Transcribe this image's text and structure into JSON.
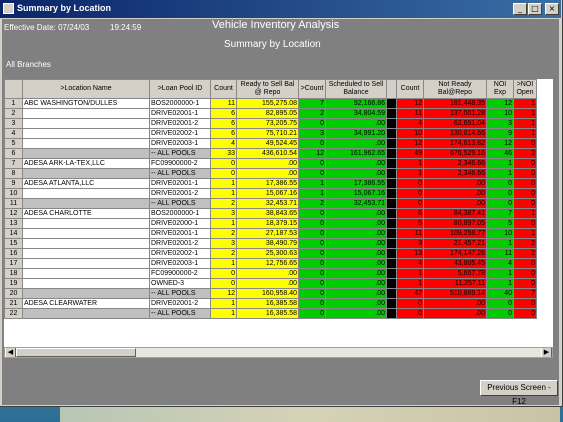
{
  "window": {
    "title": "Summary by Location"
  },
  "header": {
    "effective_date_label": "Effective Date: 07/24/03",
    "time": "19:24:59",
    "title": "Vehicle Inventory Analysis",
    "subtitle": "Summary by Location",
    "branch": "All Branches"
  },
  "colors": {
    "yellow": "#ffff00",
    "green": "#00cc00",
    "red": "#ff0000",
    "titlebar": "#0a246a"
  },
  "columns": [
    ">Location Name",
    ">Loan Pool ID",
    "Count",
    "Ready to Sell Bal @ Repo",
    ">Count",
    "Scheduled to Sell  Balance",
    "",
    "Count",
    "Not Ready Bal@Repo",
    "NOI Exp",
    ">NOI Open"
  ],
  "rows": [
    {
      "n": "1",
      "loc": "ABC WASHINGTON/DULLES",
      "pool": "BOS2000000-1",
      "c1": "11",
      "rts": "155,275.08",
      "c2": "7",
      "sched": "92,166.86",
      "c3": "12",
      "nr": "181,448.35",
      "noi": "12",
      "open": "1"
    },
    {
      "n": "2",
      "loc": "",
      "pool": "DRIVE02001-1",
      "c1": "6",
      "rts": "82,895.05",
      "c2": "2",
      "sched": "34,804.59",
      "c3": "11",
      "nr": "137,001.28",
      "noi": "10",
      "open": "1"
    },
    {
      "n": "3",
      "loc": "",
      "pool": "DRIVE02001-2",
      "c1": "6",
      "rts": "73,205.75",
      "c2": "0",
      "sched": ".00",
      "c3": "4",
      "nr": "62,651.04",
      "noi": "3",
      "open": "1"
    },
    {
      "n": "4",
      "loc": "",
      "pool": "DRIVE02002-1",
      "c1": "6",
      "rts": "75,710.21",
      "c2": "3",
      "sched": "34,991.20",
      "c3": "10",
      "nr": "130,614.66",
      "noi": "9",
      "open": "1"
    },
    {
      "n": "5",
      "loc": "",
      "pool": "DRIVE02003-1",
      "c1": "4",
      "rts": "49,524.45",
      "c2": "0",
      "sched": ".00",
      "c3": "12",
      "nr": "174,613.82",
      "noi": "12",
      "open": "0"
    },
    {
      "n": "6",
      "loc": "",
      "pool": "-- ALL POOLS",
      "c1": "33",
      "rts": "436,610.54",
      "c2": "12",
      "sched": "161,962.65",
      "c3": "49",
      "nr": "676,529.16",
      "noi": "46",
      "open": "3"
    },
    {
      "n": "7",
      "loc": "ADESA ARK-LA-TEX,LLC",
      "pool": "FC09900000-2",
      "c1": "0",
      "rts": ".00",
      "c2": "0",
      "sched": ".00",
      "c3": "1",
      "nr": "2,346.66",
      "noi": "1",
      "open": "0"
    },
    {
      "n": "8",
      "loc": "",
      "pool": "-- ALL POOLS",
      "c1": "0",
      "rts": ".00",
      "c2": "0",
      "sched": ".00",
      "c3": "1",
      "nr": "2,346.66",
      "noi": "1",
      "open": "0"
    },
    {
      "n": "9",
      "loc": "ADESA ATLANTA,LLC",
      "pool": "DRIVE02001-1",
      "c1": "1",
      "rts": "17,386.55",
      "c2": "1",
      "sched": "17,386.55",
      "c3": "0",
      "nr": ".00",
      "noi": "0",
      "open": "0"
    },
    {
      "n": "10",
      "loc": "",
      "pool": "DRIVE02001-2",
      "c1": "1",
      "rts": "15,067.16",
      "c2": "1",
      "sched": "15,067.16",
      "c3": "0",
      "nr": ".00",
      "noi": "0",
      "open": "0"
    },
    {
      "n": "11",
      "loc": "",
      "pool": "-- ALL POOLS",
      "c1": "2",
      "rts": "32,453.71",
      "c2": "2",
      "sched": "32,453.71",
      "c3": "0",
      "nr": ".00",
      "noi": "0",
      "open": "0"
    },
    {
      "n": "12",
      "loc": "ADESA CHARLOTTE",
      "pool": "BOS2000000-1",
      "c1": "3",
      "rts": "38,843.65",
      "c2": "0",
      "sched": ".00",
      "c3": "6",
      "nr": "84,387.41",
      "noi": "7",
      "open": "1"
    },
    {
      "n": "13",
      "loc": "",
      "pool": "DRIVE02000-1",
      "c1": "1",
      "rts": "18,379.15",
      "c2": "0",
      "sched": ".00",
      "c3": "5",
      "nr": "80,897.05",
      "noi": "5",
      "open": "0"
    },
    {
      "n": "14",
      "loc": "",
      "pool": "DRIVE02001-1",
      "c1": "2",
      "rts": "27,187.53",
      "c2": "0",
      "sched": ".00",
      "c3": "11",
      "nr": "109,258.77",
      "noi": "10",
      "open": "1"
    },
    {
      "n": "15",
      "loc": "",
      "pool": "DRIVE02001-2",
      "c1": "3",
      "rts": "38,490.79",
      "c2": "0",
      "sched": ".00",
      "c3": "3",
      "nr": "21,457.21",
      "noi": "1",
      "open": "2"
    },
    {
      "n": "16",
      "loc": "",
      "pool": "DRIVE02002-1",
      "c1": "2",
      "rts": "25,300.63",
      "c2": "0",
      "sched": ".00",
      "c3": "13",
      "nr": "174,147.26",
      "noi": "11",
      "open": "2"
    },
    {
      "n": "17",
      "loc": "",
      "pool": "DRIVE02003-1",
      "c1": "1",
      "rts": "12,756.65",
      "c2": "0",
      "sched": ".00",
      "c3": "4",
      "nr": "43,805.45",
      "noi": "4",
      "open": "0"
    },
    {
      "n": "18",
      "loc": "",
      "pool": "FC09900000-2",
      "c1": "0",
      "rts": ".00",
      "c2": "0",
      "sched": ".00",
      "c3": "1",
      "nr": "5,667.78",
      "noi": "1",
      "open": "0"
    },
    {
      "n": "19",
      "loc": "",
      "pool": "OWNED-3",
      "c1": "0",
      "rts": ".00",
      "c2": "0",
      "sched": ".00",
      "c3": "1",
      "nr": "11,257.11",
      "noi": "1",
      "open": "0"
    },
    {
      "n": "20",
      "loc": "",
      "pool": "-- ALL POOLS",
      "c1": "12",
      "rts": "160,958.40",
      "c2": "0",
      "sched": ".00",
      "c3": "47",
      "nr": "510,869.14",
      "noi": "40",
      "open": "7"
    },
    {
      "n": "21",
      "loc": "ADESA CLEARWATER",
      "pool": "DRIVE02001-2",
      "c1": "1",
      "rts": "16,385.58",
      "c2": "0",
      "sched": ".00",
      "c3": "0",
      "nr": ".00",
      "noi": "0",
      "open": "0"
    },
    {
      "n": "22",
      "loc": "",
      "pool": "-- ALL POOLS",
      "c1": "1",
      "rts": "16,385.58",
      "c2": "0",
      "sched": ".00",
      "c3": "0",
      "nr": ".00",
      "noi": "0",
      "open": "0"
    }
  ],
  "buttons": {
    "previous": "Previous Screen - F12"
  }
}
